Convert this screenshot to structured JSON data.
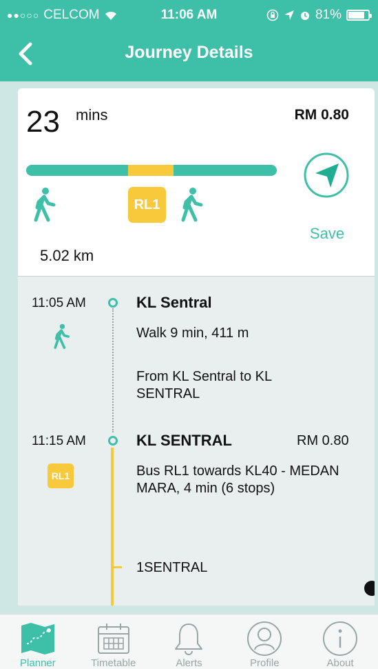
{
  "status_bar": {
    "signal": "●●○○○",
    "carrier": "CELCOM",
    "time": "11:06 AM",
    "battery": "81%"
  },
  "header": {
    "title": "Journey Details"
  },
  "summary": {
    "duration_value": "23",
    "duration_unit": "mins",
    "price": "RM 0.80",
    "route_badge": "RL1",
    "save_label": "Save",
    "distance": "5.02 km"
  },
  "itinerary": {
    "legs": [
      {
        "time": "11:05 AM",
        "stop": "KL Sentral",
        "desc1": "Walk 9 min, 411 m",
        "desc2": "From KL Sentral to KL SENTRAL"
      },
      {
        "time": "11:15 AM",
        "stop": "KL SENTRAL",
        "price": "RM 0.80",
        "badge": "RL1",
        "desc1": "Bus RL1 towards KL40 - MEDAN MARA, 4 min (6 stops)",
        "substop": "1SENTRAL"
      }
    ]
  },
  "tabs": [
    {
      "label": "Planner",
      "icon": "map-icon"
    },
    {
      "label": "Timetable",
      "icon": "calendar-icon"
    },
    {
      "label": "Alerts",
      "icon": "bell-icon"
    },
    {
      "label": "Profile",
      "icon": "user-icon"
    },
    {
      "label": "About",
      "icon": "info-icon"
    }
  ],
  "colors": {
    "accent": "#3dbfa8",
    "bus": "#f8c93a"
  }
}
